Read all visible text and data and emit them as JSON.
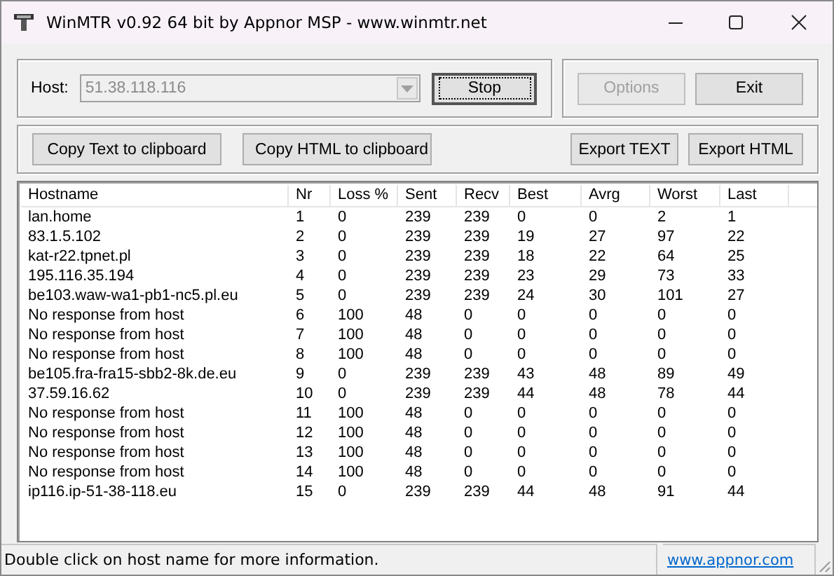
{
  "window": {
    "title": "WinMTR v0.92 64 bit by Appnor MSP - www.winmtr.net"
  },
  "host": {
    "label": "Host:",
    "value": "51.38.118.116",
    "disabled": true
  },
  "buttons": [
    {
      "label": "Stop",
      "default": true,
      "disabled": false
    },
    {
      "label": "Options",
      "default": false,
      "disabled": true
    },
    {
      "label": "Exit",
      "default": false,
      "disabled": false
    }
  ],
  "export_buttons": [
    "Copy Text to clipboard",
    "Copy HTML to clipboard",
    "Export TEXT",
    "Export HTML"
  ],
  "table": {
    "columns": [
      "Hostname",
      "Nr",
      "Loss %",
      "Sent",
      "Recv",
      "Best",
      "Avrg",
      "Worst",
      "Last"
    ],
    "rows": [
      [
        "lan.home",
        "1",
        "0",
        "239",
        "239",
        "0",
        "0",
        "2",
        "1"
      ],
      [
        "83.1.5.102",
        "2",
        "0",
        "239",
        "239",
        "19",
        "27",
        "97",
        "22"
      ],
      [
        "kat-r22.tpnet.pl",
        "3",
        "0",
        "239",
        "239",
        "18",
        "22",
        "64",
        "25"
      ],
      [
        "195.116.35.194",
        "4",
        "0",
        "239",
        "239",
        "23",
        "29",
        "73",
        "33"
      ],
      [
        "be103.waw-wa1-pb1-nc5.pl.eu",
        "5",
        "0",
        "239",
        "239",
        "24",
        "30",
        "101",
        "27"
      ],
      [
        "No response from host",
        "6",
        "100",
        "48",
        "0",
        "0",
        "0",
        "0",
        "0"
      ],
      [
        "No response from host",
        "7",
        "100",
        "48",
        "0",
        "0",
        "0",
        "0",
        "0"
      ],
      [
        "No response from host",
        "8",
        "100",
        "48",
        "0",
        "0",
        "0",
        "0",
        "0"
      ],
      [
        "be105.fra-fra15-sbb2-8k.de.eu",
        "9",
        "0",
        "239",
        "239",
        "43",
        "48",
        "89",
        "49"
      ],
      [
        "37.59.16.62",
        "10",
        "0",
        "239",
        "239",
        "44",
        "48",
        "78",
        "44"
      ],
      [
        "No response from host",
        "11",
        "100",
        "48",
        "0",
        "0",
        "0",
        "0",
        "0"
      ],
      [
        "No response from host",
        "12",
        "100",
        "48",
        "0",
        "0",
        "0",
        "0",
        "0"
      ],
      [
        "No response from host",
        "13",
        "100",
        "48",
        "0",
        "0",
        "0",
        "0",
        "0"
      ],
      [
        "No response from host",
        "14",
        "100",
        "48",
        "0",
        "0",
        "0",
        "0",
        "0"
      ],
      [
        "ip116.ip-51-38-118.eu",
        "15",
        "0",
        "239",
        "239",
        "44",
        "48",
        "91",
        "44"
      ]
    ]
  },
  "status_bar": {
    "message": "Double click on host name for more information.",
    "link": "www.appnor.com"
  }
}
